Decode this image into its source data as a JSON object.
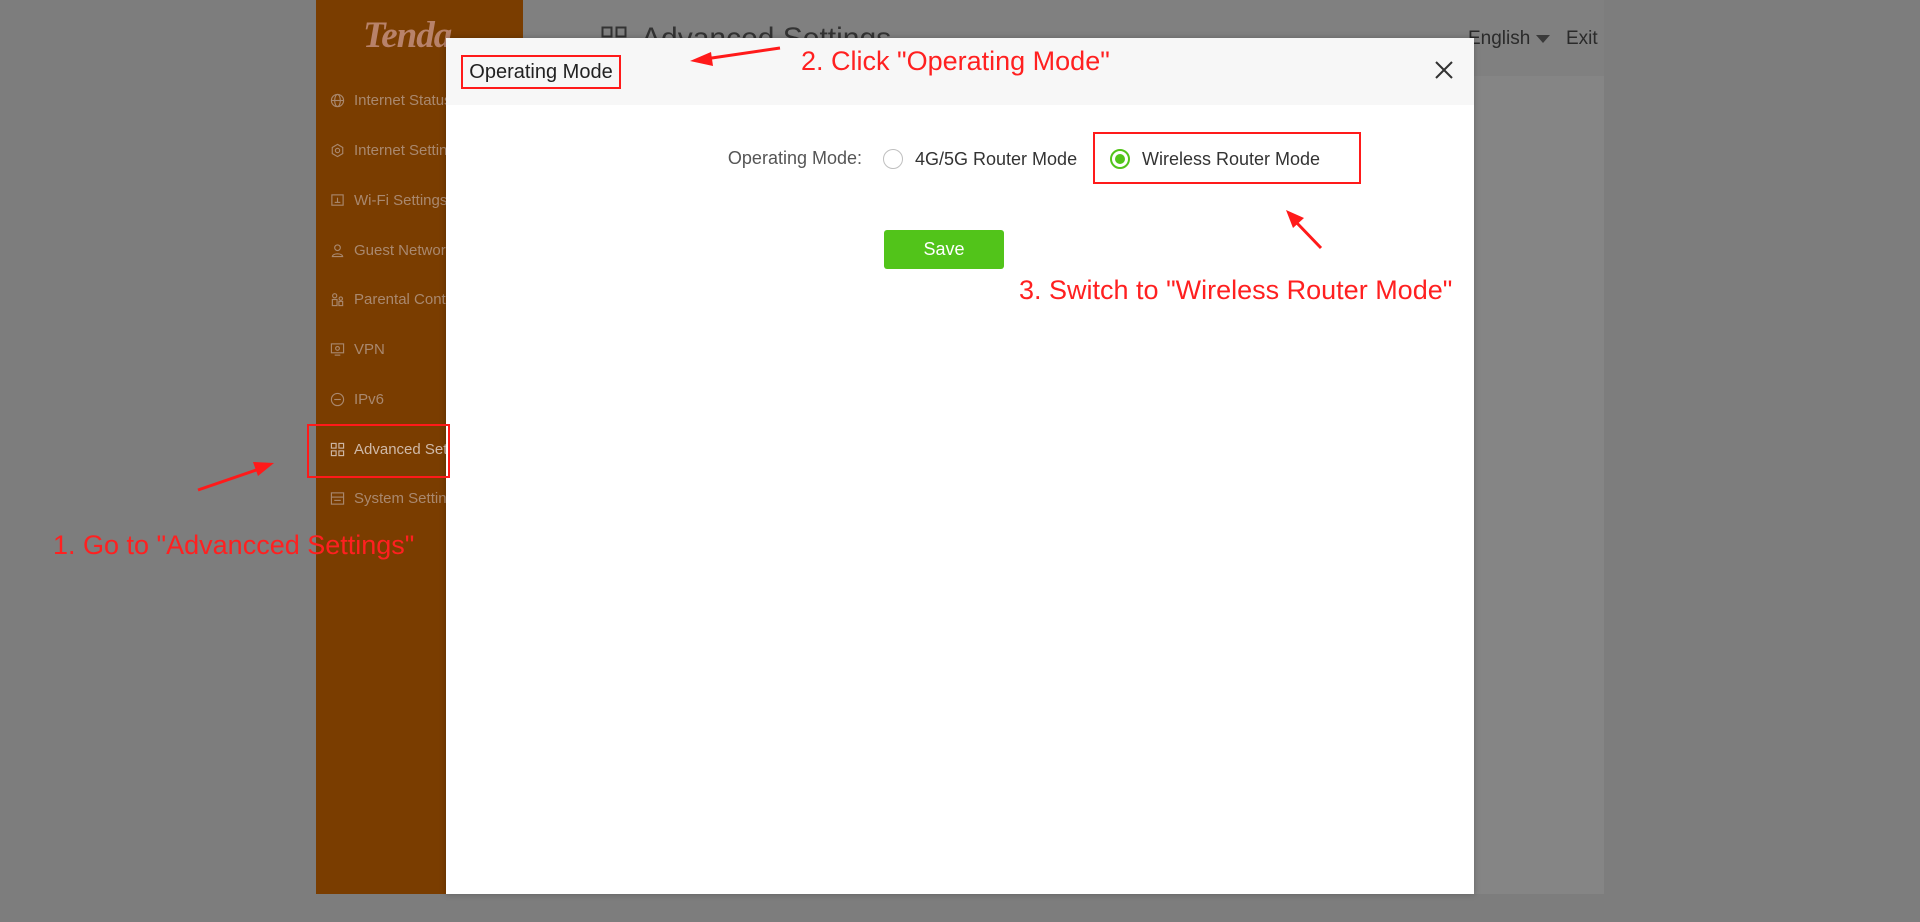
{
  "app": {
    "logo": "Tenda",
    "page_title": "Advanced Settings",
    "language": "English",
    "exit": "Exit"
  },
  "sidebar": {
    "items": [
      {
        "label": "Internet Status",
        "icon": "globe-icon"
      },
      {
        "label": "Internet Settings",
        "icon": "settings-icon"
      },
      {
        "label": "Wi-Fi Settings",
        "icon": "wifi-icon"
      },
      {
        "label": "Guest Network",
        "icon": "user-icon"
      },
      {
        "label": "Parental Control",
        "icon": "family-icon"
      },
      {
        "label": "VPN",
        "icon": "vpn-icon"
      },
      {
        "label": "IPv6",
        "icon": "ipv6-icon"
      },
      {
        "label": "Advanced Settings",
        "icon": "grid-icon"
      },
      {
        "label": "System Settings",
        "icon": "system-icon"
      }
    ]
  },
  "modal": {
    "title": "Operating Mode",
    "field_label": "Operating Mode:",
    "options": [
      {
        "label": "4G/5G Router Mode",
        "checked": false
      },
      {
        "label": "Wireless Router Mode",
        "checked": true
      }
    ],
    "save_label": "Save"
  },
  "annotations": {
    "step1": "1. Go to \"Advancced Settings\"",
    "step2": "2. Click \"Operating Mode\"",
    "step3": "3. Switch to \"Wireless Router Mode\""
  },
  "colors": {
    "accent_green": "#52c41a",
    "annotation_red": "#ff1a1a",
    "sidebar_orange": "#7a3d00"
  }
}
